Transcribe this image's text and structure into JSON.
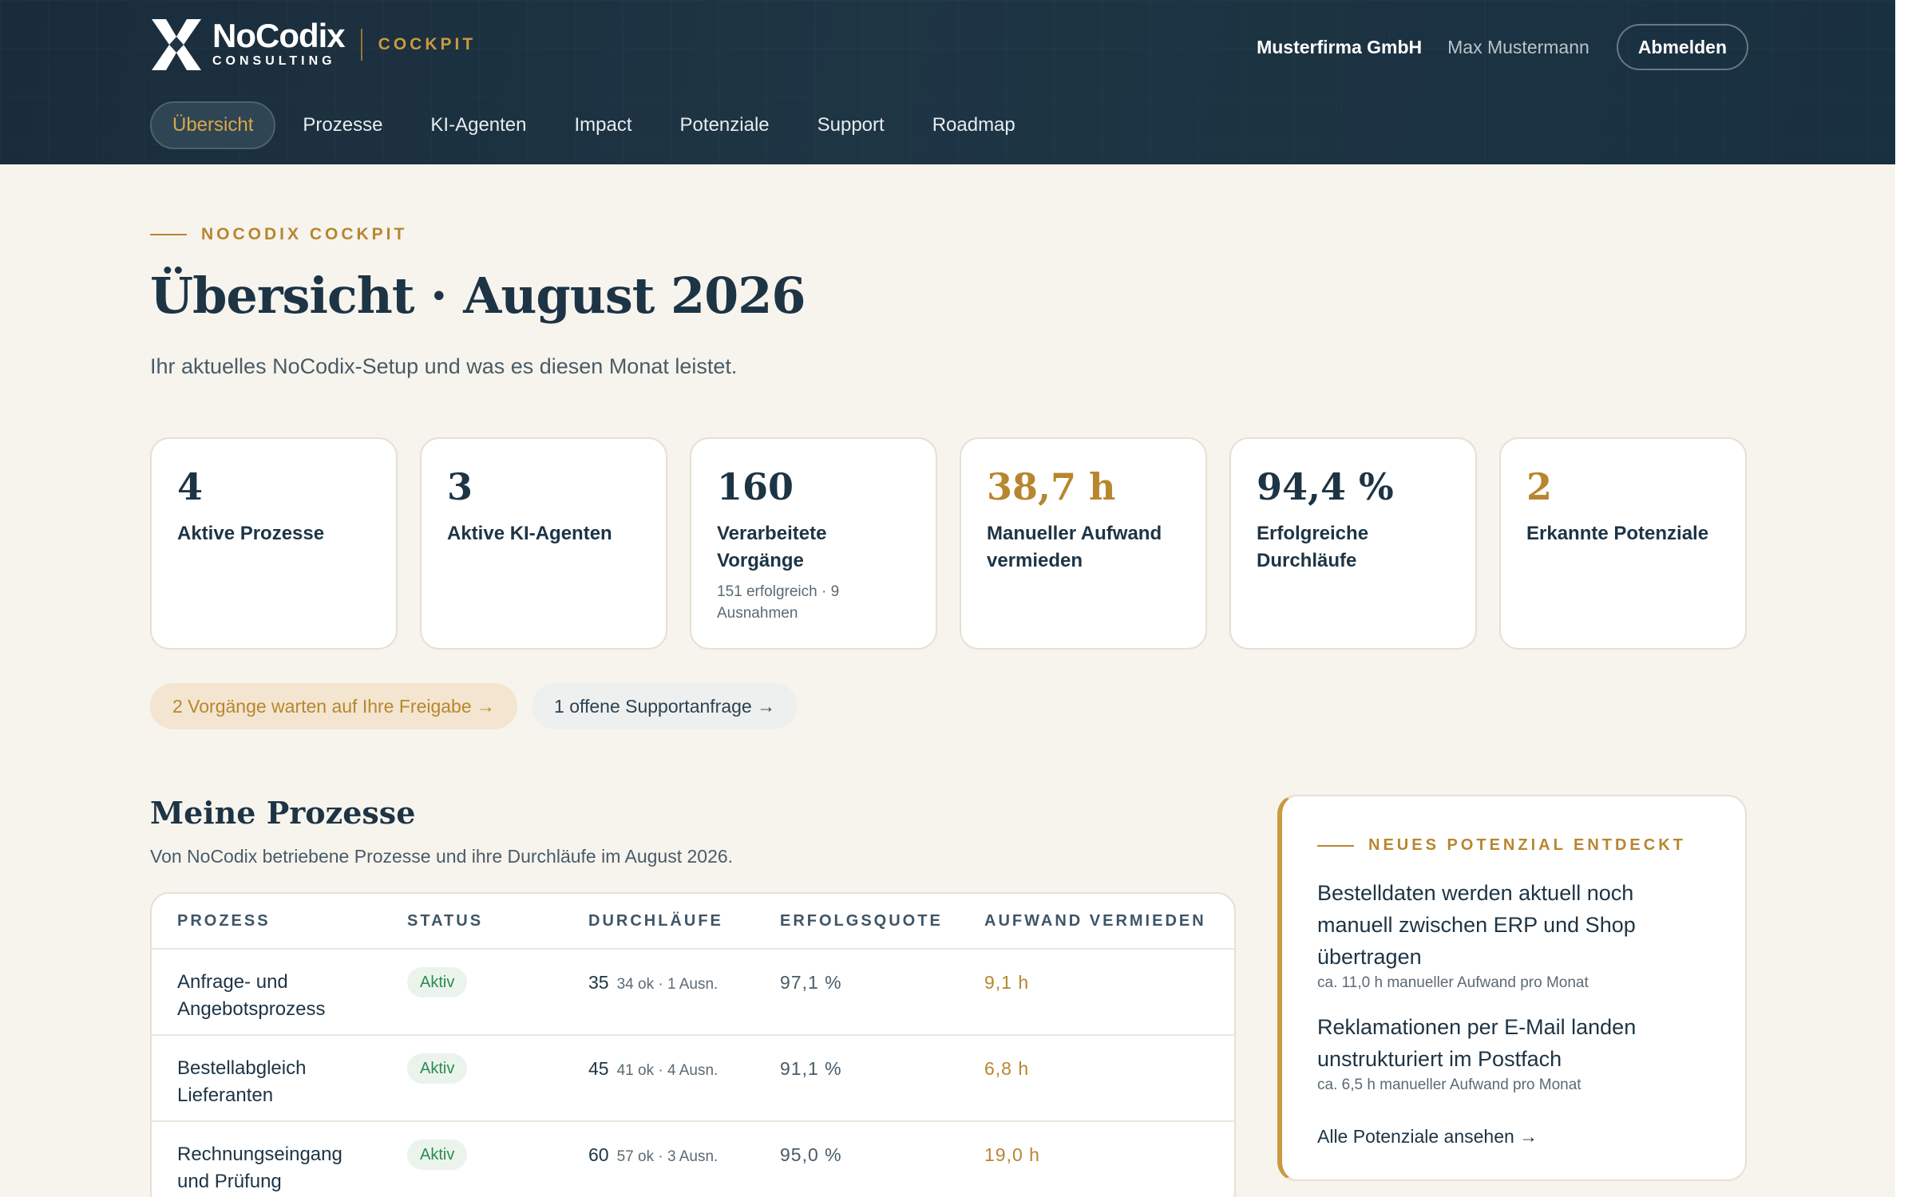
{
  "header": {
    "logo_name": "NoCodix",
    "logo_sub": "CONSULTING",
    "section_label": "COCKPIT",
    "company": "Musterfirma GmbH",
    "user": "Max Mustermann",
    "logout_label": "Abmelden"
  },
  "nav": {
    "items": [
      {
        "label": "Übersicht",
        "active": true
      },
      {
        "label": "Prozesse"
      },
      {
        "label": "KI-Agenten"
      },
      {
        "label": "Impact"
      },
      {
        "label": "Potenziale"
      },
      {
        "label": "Support"
      },
      {
        "label": "Roadmap"
      }
    ]
  },
  "page": {
    "eyebrow": "NOCODIX COCKPIT",
    "title": "Übersicht · August 2026",
    "subtitle": "Ihr aktuelles NoCodix-Setup und was es diesen Monat leistet."
  },
  "kpis": [
    {
      "value": "4",
      "label": "Aktive Prozesse",
      "sub": ""
    },
    {
      "value": "3",
      "label": "Aktive KI-Agenten",
      "sub": ""
    },
    {
      "value": "160",
      "label": "Verarbeitete Vorgänge",
      "sub": "151 erfolgreich · 9 Ausnahmen"
    },
    {
      "value": "38,7 h",
      "label": "Manueller Aufwand vermieden",
      "sub": "",
      "accent": "#b8862f"
    },
    {
      "value": "94,4 %",
      "label": "Erfolgreiche Durchläufe",
      "sub": ""
    },
    {
      "value": "2",
      "label": "Erkannte Potenziale",
      "sub": "",
      "accent": "#b8862f"
    }
  ],
  "pills": {
    "approval": "2 Vorgänge warten auf Ihre Freigabe →",
    "support": "1 offene Supportanfrage →"
  },
  "processes": {
    "title": "Meine Prozesse",
    "subtitle": "Von NoCodix betriebene Prozesse und ihre Durchläufe im August 2026.",
    "columns": [
      "PROZESS",
      "STATUS",
      "DURCHLÄUFE",
      "ERFOLGSQUOTE",
      "AUFWAND VERMIEDEN"
    ],
    "rows": [
      {
        "name": "Anfrage- und Angebotsprozess",
        "status": "Aktiv",
        "runs": "35",
        "runs_detail": "34 ok · 1 Ausn.",
        "rate": "97,1 %",
        "saved": "9,1 h"
      },
      {
        "name": "Bestellabgleich Lieferanten",
        "status": "Aktiv",
        "runs": "45",
        "runs_detail": "41 ok · 4 Ausn.",
        "rate": "91,1 %",
        "saved": "6,8 h"
      },
      {
        "name": "Rechnungseingang und Prüfung",
        "status": "Aktiv",
        "runs": "60",
        "runs_detail": "57 ok · 3 Ausn.",
        "rate": "95,0 %",
        "saved": "19,0 h"
      }
    ]
  },
  "potential": {
    "eyebrow": "NEUES POTENZIAL ENTDECKT",
    "items": [
      {
        "title": "Bestelldaten werden aktuell noch manuell zwischen ERP und Shop übertragen",
        "sub": "ca. 11,0 h manueller Aufwand pro Monat"
      },
      {
        "title": "Reklamationen per E-Mail landen unstrukturiert im Postfach",
        "sub": "ca. 6,5 h manueller Aufwand pro Monat"
      }
    ],
    "link": "Alle Potenziale ansehen →"
  },
  "colors": {
    "header_bg": "#1d3445",
    "accent": "#b8862f",
    "background": "#f7f4ee",
    "success": "#2c8a50"
  }
}
